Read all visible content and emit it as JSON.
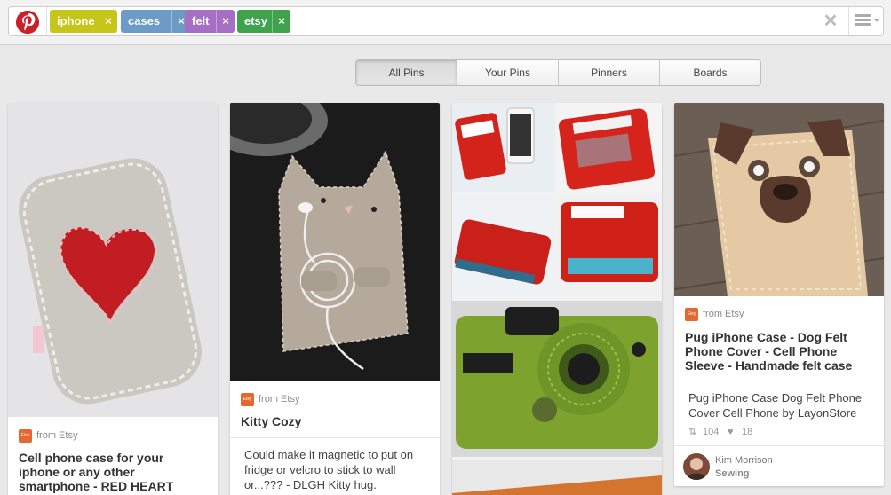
{
  "search": {
    "tags": [
      {
        "label": "iphone",
        "color": "#c5c51a"
      },
      {
        "label": "cases",
        "color": "#6c9bc6"
      },
      {
        "label": "felt",
        "color": "#a76fc4"
      },
      {
        "label": "etsy",
        "color": "#3ea34c"
      }
    ],
    "remove_glyph": "×",
    "clear_glyph": "✕"
  },
  "brand": {
    "logo_icon": "pinterest-logo-icon",
    "color": "#cb2027"
  },
  "filters": {
    "tabs": [
      {
        "label": "All Pins",
        "active": true
      },
      {
        "label": "Your Pins",
        "active": false
      },
      {
        "label": "Pinners",
        "active": false
      },
      {
        "label": "Boards",
        "active": false
      }
    ]
  },
  "pins": [
    {
      "source": "from Etsy",
      "source_icon_text": "Etsy",
      "title": "Cell phone case for your iphone or any other smartphone - RED HEART",
      "image": "grey felt phone case with red heart"
    },
    {
      "source": "from Etsy",
      "source_icon_text": "Etsy",
      "title": "Kitty Cozy",
      "description": "Could make it magnetic to put on fridge or velcro to stick to wall or...??? - DLGH Kitty hug.",
      "image": "felt cat phone case with earbuds"
    },
    {
      "image": "collage of red calculator and green camera felt cases"
    },
    {
      "source": "from Etsy",
      "source_icon_text": "Etsy",
      "title": "Pug iPhone Case - Dog Felt Phone Cover - Cell Phone Sleeve - Handmade felt case",
      "description": "Pug iPhone Case Dog Felt Phone Cover Cell Phone by LayonStore",
      "repins": "104",
      "likes": "18",
      "pinner_name": "Kim Morrison",
      "pinner_board": "Sewing",
      "image": "tan felt pug phone case"
    }
  ]
}
